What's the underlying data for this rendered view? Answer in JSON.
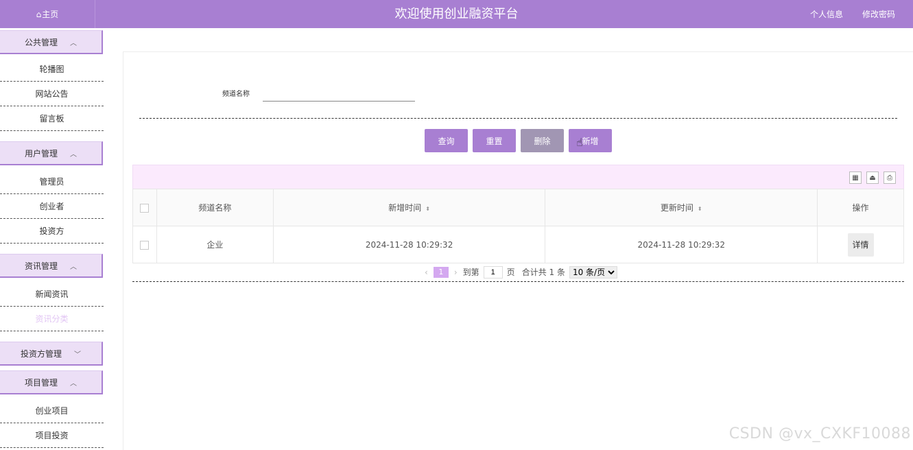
{
  "header": {
    "home_label": "主页",
    "site_title": "欢迎使用创业融资平台",
    "profile_link": "个人信息",
    "change_password_link": "修改密码"
  },
  "sidebar": {
    "groups": [
      {
        "label": "公共管理",
        "chevron": "^",
        "items": [
          "轮播图",
          "网站公告",
          "留言板"
        ]
      },
      {
        "label": "用户管理",
        "chevron": "^",
        "items": [
          "管理员",
          "创业者",
          "投资方"
        ]
      },
      {
        "label": "资讯管理",
        "chevron": "^",
        "items": [
          "新闻资讯",
          "资讯分类"
        ]
      },
      {
        "label": "投资方管理",
        "chevron": "v",
        "items": []
      },
      {
        "label": "项目管理",
        "chevron": "^",
        "items": [
          "创业项目",
          "项目投资"
        ]
      }
    ],
    "active_item": "资讯分类"
  },
  "search": {
    "label": "频道名称",
    "value": ""
  },
  "buttons": {
    "query": "查询",
    "reset": "重置",
    "delete": "删除",
    "add": "新增"
  },
  "table": {
    "columns": [
      "频道名称",
      "新增时间",
      "更新时间",
      "操作"
    ],
    "rows": [
      {
        "name": "企业",
        "created": "2024-11-28 10:29:32",
        "updated": "2024-11-28 10:29:32",
        "action": "详情"
      }
    ]
  },
  "pager": {
    "current_page": "1",
    "goto_prefix": "到第",
    "goto_value": "1",
    "goto_suffix": "页",
    "total_text": "合计共 1 条",
    "page_size": "10 条/页"
  },
  "watermark": "CSDN @vx_CXKF10088",
  "colors": {
    "primary": "#a87fd2",
    "disabled_button": "#a196b3",
    "toolbar_bg": "#fbeafd",
    "active_menu_text": "#e2c6f4"
  }
}
